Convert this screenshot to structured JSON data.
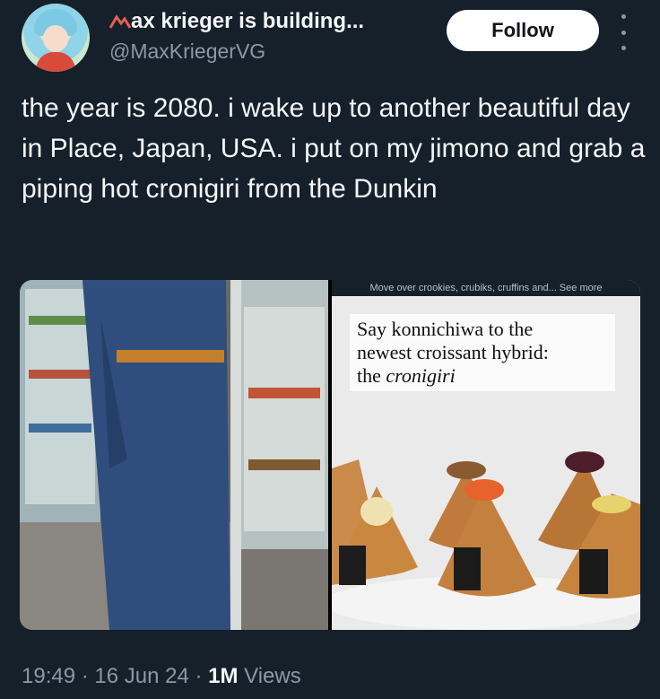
{
  "author": {
    "name": "ax krieger is building...",
    "name_prefix_icon": "mountain-logo-icon",
    "handle": "@MaxKriegerVG"
  },
  "follow_label": "Follow",
  "more_icon": "more-vertical-icon",
  "tweet": {
    "text": "the year is 2080. i wake up to another beautiful day in Place, Japan, USA. i put on my jimono and grab a piping hot cronigiri from the Dunkin"
  },
  "media": {
    "left_image_description": "photo-person-in-denim-kimono",
    "right_image": {
      "source_caption": "Move over crookies, crubiks, cruffins and... See more",
      "headline_line1": "Say konnichiwa to the",
      "headline_line2": "newest croissant hybrid:",
      "headline_line3_prefix": "the ",
      "headline_line3_italic": "cronigiri"
    }
  },
  "meta": {
    "time": "19:49",
    "separator1": " · ",
    "date": "16 Jun 24",
    "separator2": " · ",
    "views_count": "1M",
    "views_label": " Views"
  }
}
